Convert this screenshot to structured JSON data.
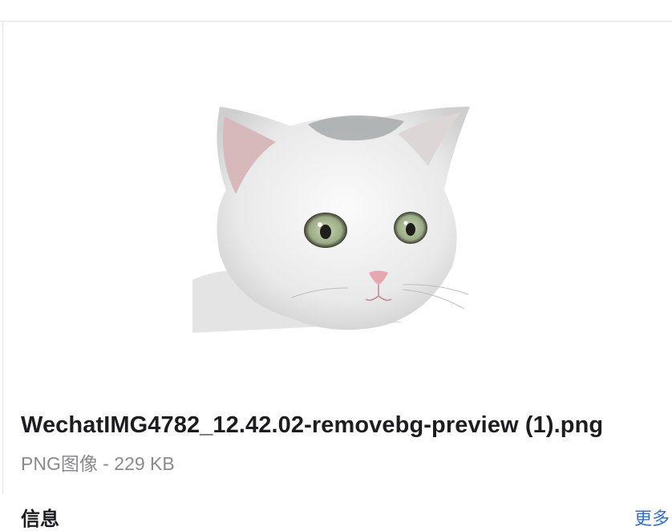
{
  "file": {
    "name": "WechatIMG4782_12.42.02-removebg-preview (1).png",
    "meta": "PNG图像 - 229 KB"
  },
  "info": {
    "heading": "信息",
    "more_label": "更多"
  },
  "preview": {
    "icon": "cat-image-thumbnail"
  }
}
